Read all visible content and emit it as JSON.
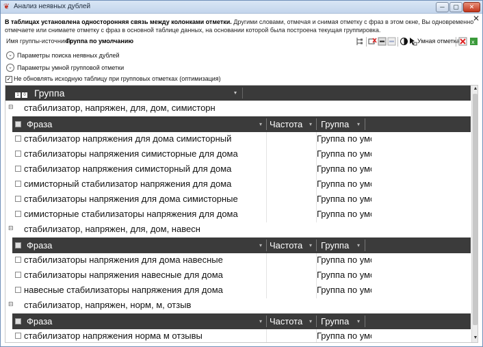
{
  "window": {
    "title": "Анализ неявных дублей",
    "minimize_glyph": "─",
    "maximize_glyph": "▢",
    "close_glyph": "✕",
    "inner_close_glyph": "✕"
  },
  "info": {
    "bold": "В таблицах установлена односторонняя связь между колонками отметки.",
    "rest": " Другими словами, отмечая и снимая отметку с фраз в этом окне, Вы одновременно отмечаете или снимаете отметку с фраз в основной таблице данных, на основании которой была построена текущая группировка."
  },
  "source": {
    "label": "Имя группы-источника:",
    "value": "Группа по умолчанию"
  },
  "toolbar": {
    "smart_label": "Умная отметка",
    "icons": [
      "tree-icon",
      "uncheck-icon",
      "minus-icon",
      "minus-light-icon",
      "contrast-icon",
      "cursor-icon",
      "excel-red-icon",
      "excel-green-icon"
    ]
  },
  "expanders": [
    {
      "label": "Параметры поиска неявных дублей",
      "glyph": "⌄"
    },
    {
      "label": "Параметры умной групповой отметки",
      "glyph": "⌄"
    }
  ],
  "option": {
    "checked": true,
    "glyph": "✓",
    "label": "Не обновлять исходную таблицу при групповых отметках (оптимизация)"
  },
  "grid": {
    "main_header": "Группа",
    "sub_headers": {
      "phrase": "Фраза",
      "freq": "Частота",
      "group": "Группа"
    },
    "toggle_glyph": "⊟",
    "filter_glyph": "▾",
    "groups": [
      {
        "title": "стабилизатор, напряжен, для, дом, симисторн",
        "rows": [
          {
            "phrase": "стабилизатор напряжения для дома симисторный",
            "freq": "",
            "group": "Группа по умолчанию"
          },
          {
            "phrase": "стабилизаторы напряжения симисторные для дома",
            "freq": "",
            "group": "Группа по умолчанию"
          },
          {
            "phrase": "стабилизатор напряжения симисторный для дома",
            "freq": "",
            "group": "Группа по умолчанию"
          },
          {
            "phrase": "симисторный стабилизатор напряжения для дома",
            "freq": "",
            "group": "Группа по умолчанию"
          },
          {
            "phrase": "стабилизаторы напряжения для дома симисторные",
            "freq": "",
            "group": "Группа по умолчанию"
          },
          {
            "phrase": "симисторные стабилизаторы напряжения для дома",
            "freq": "",
            "group": "Группа по умолчанию"
          }
        ]
      },
      {
        "title": "стабилизатор, напряжен, для, дом, навесн",
        "rows": [
          {
            "phrase": "стабилизаторы напряжения для дома навесные",
            "freq": "",
            "group": "Группа по умолчанию"
          },
          {
            "phrase": "стабилизаторы напряжения навесные для дома",
            "freq": "",
            "group": "Группа по умолчанию"
          },
          {
            "phrase": "навесные стабилизаторы напряжения для дома",
            "freq": "",
            "group": "Группа по умолчанию"
          }
        ]
      },
      {
        "title": "стабилизатор, напряжен, норм, м, отзыв",
        "rows": [
          {
            "phrase": "стабилизатор напряжения норма м отзывы",
            "freq": "",
            "group": "Группа по умолчанию"
          }
        ]
      }
    ]
  },
  "scrollbar": {
    "up_glyph": "▲",
    "down_glyph": "▼"
  },
  "colors": {
    "header_bg": "#3a3a3a",
    "titlebar": "#c3d5ec",
    "close_button": "#c2361c"
  }
}
